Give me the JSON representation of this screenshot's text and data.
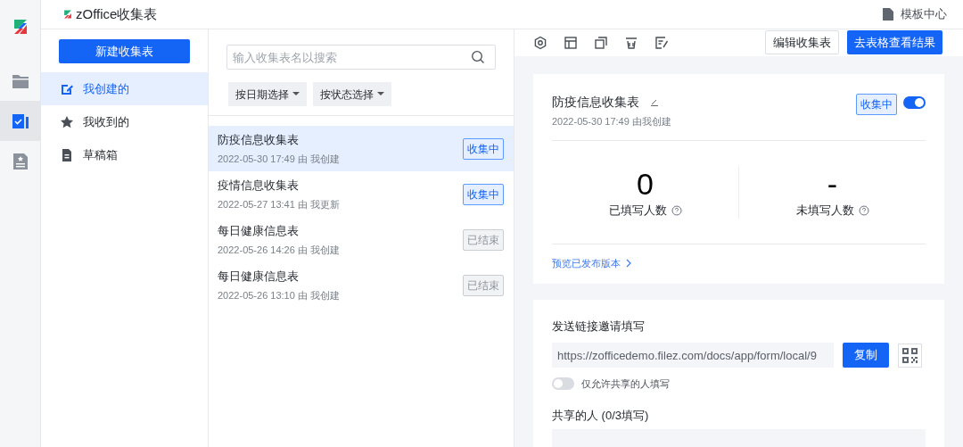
{
  "app": {
    "title": "zOffice收集表",
    "template_center": "模板中心"
  },
  "rail": [
    {
      "kind": "folder",
      "selected": false
    },
    {
      "kind": "form",
      "selected": true
    },
    {
      "kind": "starred-doc",
      "selected": false
    }
  ],
  "sidebar": {
    "new_button": "新建收集表",
    "items": [
      {
        "label": "我创建的",
        "kind": "edit",
        "selected": true
      },
      {
        "label": "我收到的",
        "kind": "star",
        "selected": false
      },
      {
        "label": "草稿箱",
        "kind": "draft",
        "selected": false
      }
    ]
  },
  "list": {
    "search": {
      "placeholder": "输入收集表名以搜索"
    },
    "filters": [
      "按日期选择",
      "按状态选择"
    ],
    "items": [
      {
        "title": "防疫信息收集表",
        "meta": "2022-05-30 17:49 由 我创建",
        "status": "收集中",
        "active": true,
        "selected": true
      },
      {
        "title": "疫情信息收集表",
        "meta": "2022-05-27 13:41 由 我更新",
        "status": "收集中",
        "active": true,
        "selected": false
      },
      {
        "title": "每日健康信息表",
        "meta": "2022-05-26 14:26 由 我创建",
        "status": "已结束",
        "active": false,
        "selected": false
      },
      {
        "title": "每日健康信息表",
        "meta": "2022-05-26 13:10 由 我创建",
        "status": "已结束",
        "active": false,
        "selected": false
      }
    ]
  },
  "toolbar": {
    "tools": [
      {
        "kind": "settings"
      },
      {
        "kind": "layout"
      },
      {
        "kind": "copy"
      },
      {
        "kind": "delete"
      },
      {
        "kind": "edit-list"
      }
    ],
    "edit_button": "编辑收集表",
    "results_button": "去表格查看结果"
  },
  "detail": {
    "title": "防疫信息收集表",
    "meta": "2022-05-30 17:49 由我创建",
    "status": "收集中",
    "collecting": true,
    "stats": [
      {
        "value": "0",
        "label": "已填写人数"
      },
      {
        "value": "-",
        "label": "未填写人数"
      }
    ],
    "preview_link": "预览已发布版本"
  },
  "share": {
    "heading": "发送链接邀请填写",
    "url": "https://zofficedemo.filez.com/docs/app/form/local/9",
    "copy_button": "复制",
    "only_shared": false,
    "only_shared_label": "仅允许共享的人填写",
    "people_heading": "共享的人 (0/3填写)"
  }
}
